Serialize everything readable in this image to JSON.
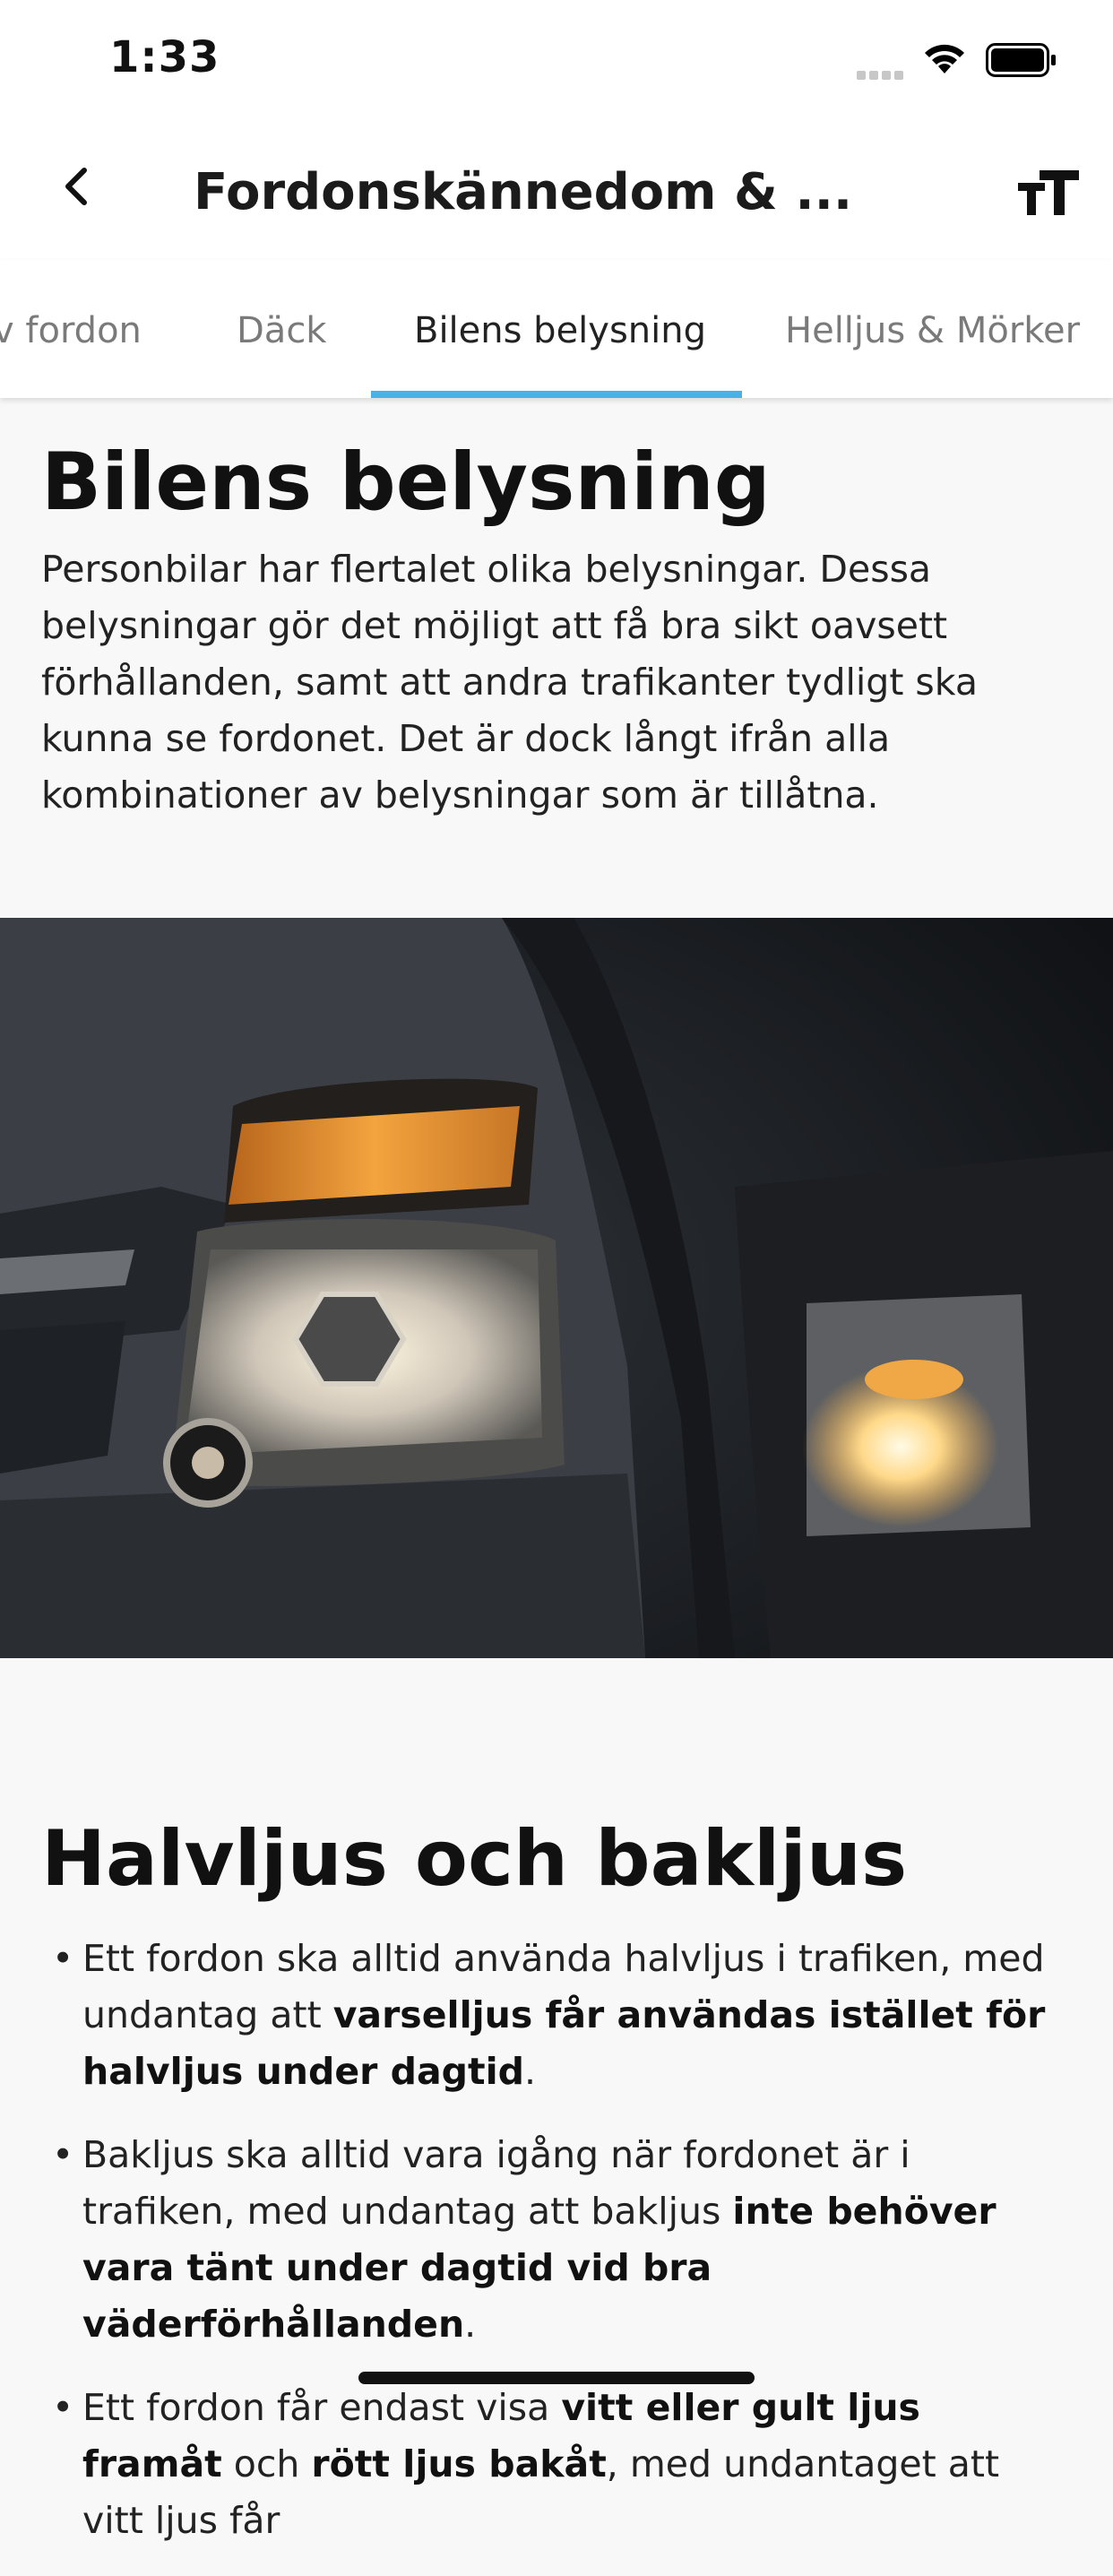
{
  "status_bar": {
    "time": "1:33"
  },
  "nav": {
    "title": "Fordonskännedom & ..."
  },
  "tabs": [
    {
      "label": "v fordon"
    },
    {
      "label": "Däck"
    },
    {
      "label": "Bilens belysning"
    },
    {
      "label": "Helljus & Mörker"
    }
  ],
  "active_tab": "Bilens belysning",
  "section1": {
    "title": "Bilens belysning",
    "body": "Personbilar har flertalet olika belysningar. Dessa belysningar gör det möjligt att få bra sikt oavsett förhållanden, samt att andra trafikanter tydligt ska kunna se fordonet. Det är dock långt ifrån alla kombinationer av belysningar som är tillåtna."
  },
  "section2": {
    "title": "Halvljus och bakljus",
    "bullets": [
      {
        "pre": "Ett fordon ska alltid använda halvljus i trafiken, med undantag att ",
        "bold": "varselljus får användas istället för halvljus under dagtid",
        "post": "."
      },
      {
        "pre": "Bakljus ska alltid vara igång när fordonet är i trafiken, med undantag att bakljus ",
        "bold": "inte behöver vara tänt under dagtid vid bra väderförhållanden",
        "post": "."
      },
      {
        "pre": "Ett fordon får endast visa ",
        "bold": "vitt eller gult ljus framåt",
        "post": " och ",
        "bold2": "rött ljus bakåt",
        "post2": ", med undantaget att vitt ljus får"
      }
    ]
  },
  "colors": {
    "accent": "#4bb0e6",
    "background": "#f8f8f8"
  }
}
